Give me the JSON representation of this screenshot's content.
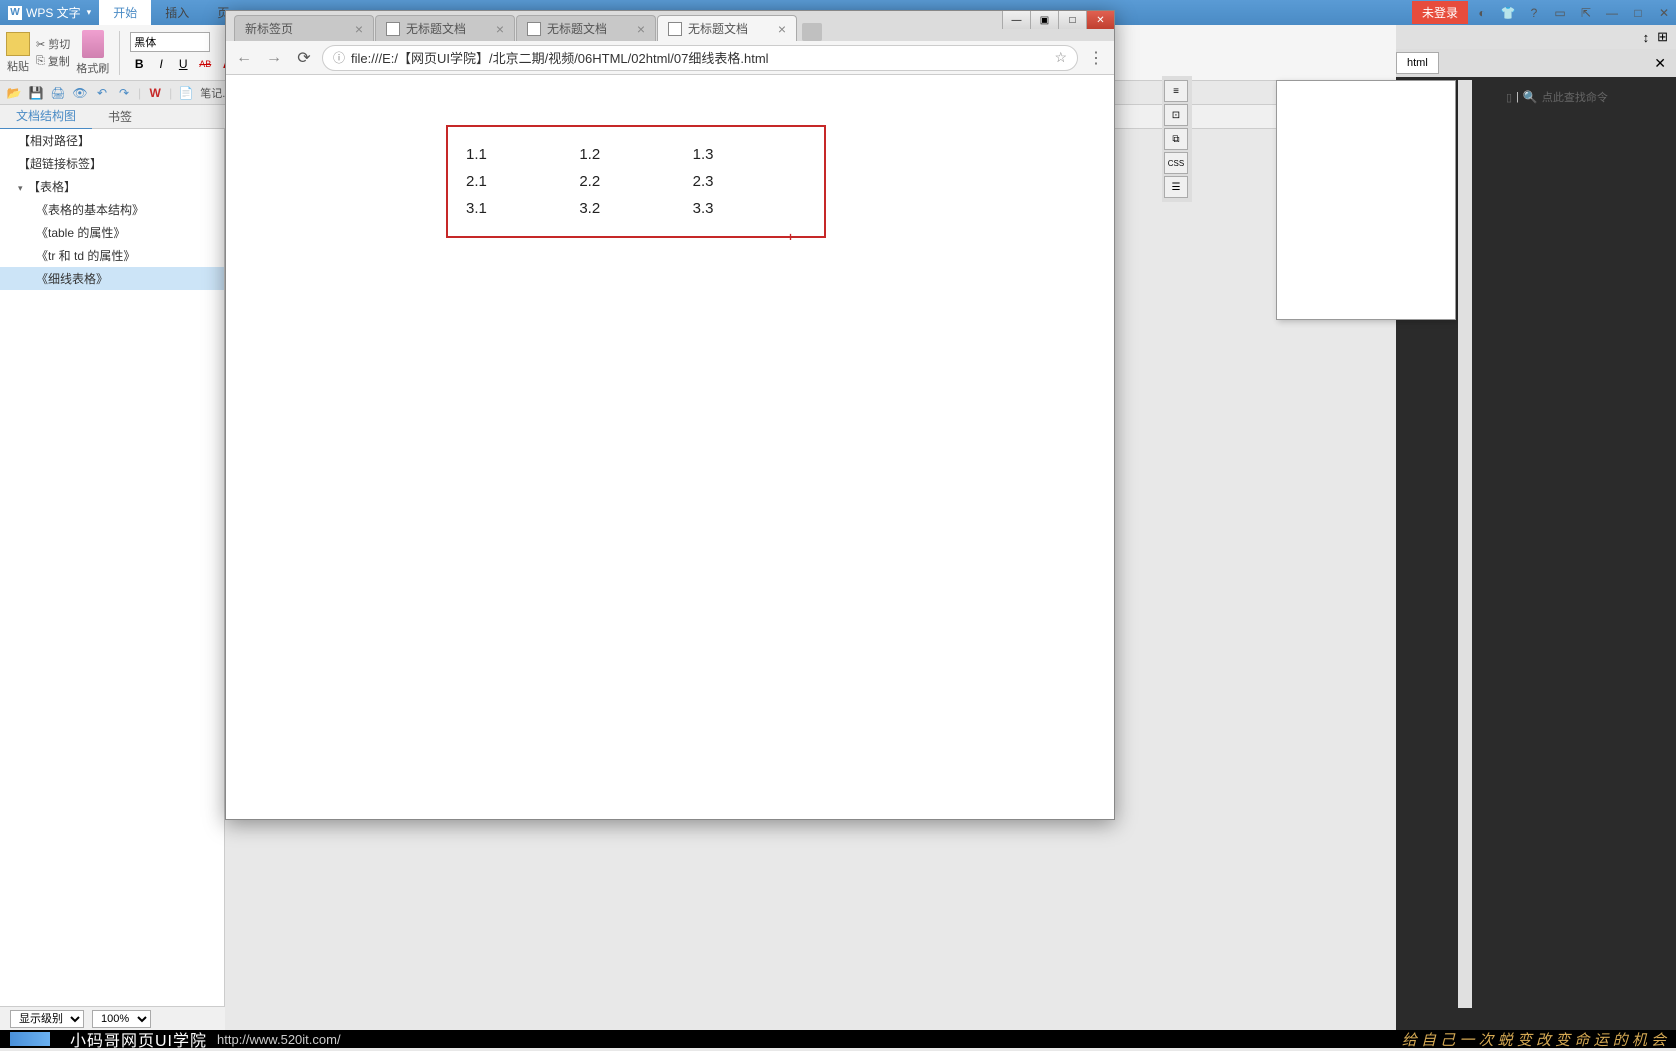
{
  "wps": {
    "app_name": "WPS 文字",
    "menu_tabs": [
      "开始",
      "插入",
      "页"
    ],
    "login_label": "未登录",
    "toolbar": {
      "paste_label": "粘贴",
      "cut_label": "剪切",
      "copy_label": "复制",
      "format_brush_label": "格式刷",
      "font_name": "黑体",
      "bold": "B",
      "italic": "I",
      "underline": "U",
      "strike": "AB",
      "highlight": "A"
    },
    "quickaccess": {
      "notes_label": "笔记.d"
    },
    "navtabs": [
      "文档结构图",
      "书签"
    ],
    "tree": [
      {
        "label": "【相对路径】",
        "level": 1
      },
      {
        "label": "【超链接标签】",
        "level": 1
      },
      {
        "label": "【表格】",
        "level": 1,
        "expanded": true
      },
      {
        "label": "《表格的基本结构》",
        "level": 2
      },
      {
        "label": "《table 的属性》",
        "level": 2
      },
      {
        "label": "《tr 和 td 的属性》",
        "level": 2
      },
      {
        "label": "《细线表格》",
        "level": 2,
        "selected": true
      }
    ],
    "bottom": {
      "display_level": "显示级别",
      "zoom": "100%"
    },
    "search_placeholder": "点此查找命令"
  },
  "editor": {
    "tab_name": "html",
    "code_fragment": "/>"
  },
  "chrome": {
    "tabs": [
      {
        "title": "新标签页",
        "active": false
      },
      {
        "title": "无标题文档",
        "active": false
      },
      {
        "title": "无标题文档",
        "active": false
      },
      {
        "title": "无标题文档",
        "active": true
      }
    ],
    "url": "file:///E:/【网页UI学院】/北京二期/视频/06HTML/02html/07细线表格.html",
    "table": {
      "rows": [
        [
          "1.1",
          "1.2",
          "1.3"
        ],
        [
          "2.1",
          "2.2",
          "2.3"
        ],
        [
          "3.1",
          "3.2",
          "3.3"
        ]
      ]
    }
  },
  "taskbar": {
    "brand": "小码哥网页UI学院",
    "url": "http://www.520it.com/",
    "slogan": "给 自 己 一 次 蜕 变 改 变 命 运 的 机 会"
  }
}
